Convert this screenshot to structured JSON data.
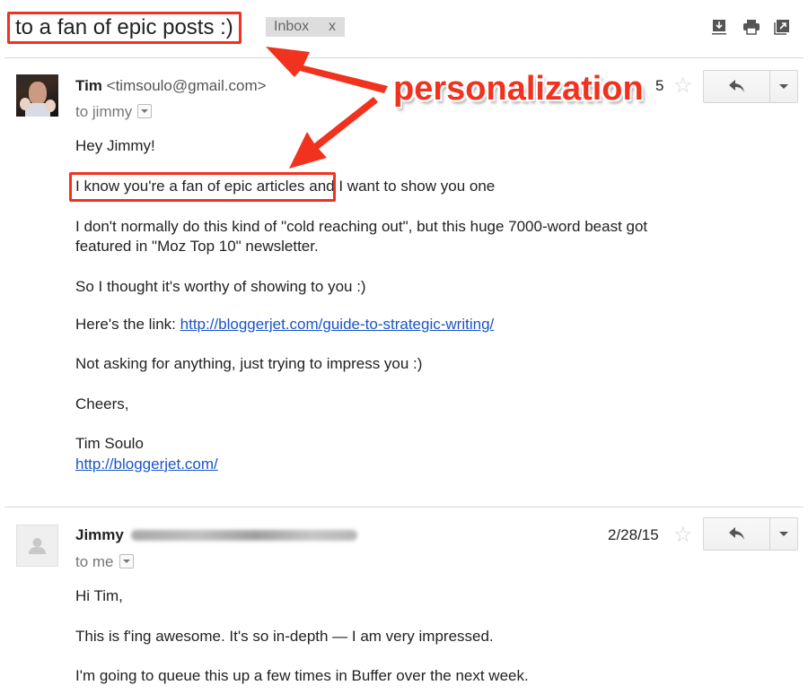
{
  "subject": {
    "title": "to a fan of epic posts :)",
    "label": "Inbox",
    "label_remove": "x"
  },
  "toolbar": {
    "icons": [
      "download-icon",
      "print-icon",
      "open-in-new-window-icon"
    ]
  },
  "annotation": {
    "text": "personalization",
    "color": "#f0321e"
  },
  "messages": [
    {
      "sender_name": "Tim",
      "sender_email": "<timsoulo@gmail.com>",
      "to": "to jimmy",
      "date": "5",
      "body": {
        "greeting": "Hey Jimmy!",
        "highlighted": "I know you're a fan of epic articles",
        "line1_rest": " and I want to show you one",
        "para2_line1": "I don't normally do this kind of \"cold reaching out\", but this huge 7000-word beast got",
        "para2_line2": "featured in \"Moz Top 10\" newsletter.",
        "para3": "So I thought it's worthy of showing to you :)",
        "link_prefix": "Here's the link: ",
        "link": "http://bloggerjet.com/guide-to-strategic-writing/",
        "para5": "Not asking for anything, just trying to impress you :)",
        "closing": "Cheers,",
        "signature_name": "Tim Soulo",
        "signature_link": "http://bloggerjet.com/"
      }
    },
    {
      "sender_name": "Jimmy",
      "to": "to me",
      "date": "2/28/15",
      "body": {
        "greeting": "Hi Tim,",
        "para1": "This is f'ing awesome. It's so in-depth — I am very impressed.",
        "para2": "I'm going to queue this up a few times in Buffer over the next week."
      }
    }
  ]
}
